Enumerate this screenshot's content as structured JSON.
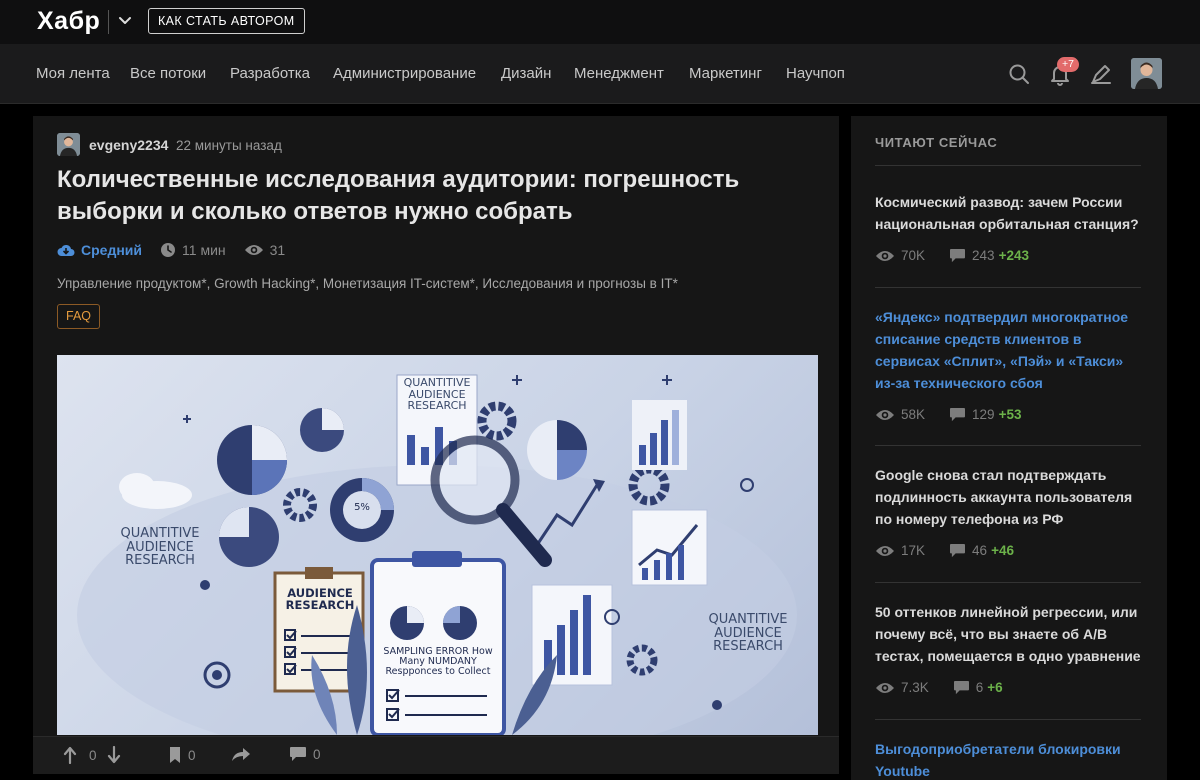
{
  "header": {
    "logo": "Хабр",
    "author_button": "КАК СТАТЬ АВТОРОМ",
    "notifications_badge": "+7"
  },
  "nav": {
    "items": [
      "Моя лента",
      "Все потоки",
      "Разработка",
      "Администрирование",
      "Дизайн",
      "Менеджмент",
      "Маркетинг",
      "Научпоп"
    ]
  },
  "article": {
    "author": "evgeny2234",
    "time": "22 минуты назад",
    "title": "Количественные исследования аудитории: погрешность выборки и сколько ответов нужно собрать",
    "level": "Средний",
    "read_time": "11 мин",
    "views": "31",
    "hubs": "Управление продуктом*, Growth Hacking*, Монетизация IT-систем*, Исследования и прогнозы в IT*",
    "badge": "FAQ",
    "cover_texts": {
      "top": "QUANTITIVE AUDIENCE RESEARCH",
      "left": "QUANTITIVE AUDIENCE RESEARCH",
      "right": "QUANTITIVE AUDIENCE RESEARCH",
      "clipboard": "AUDIENCE RESEARCH",
      "center": "SAMPLING ERROR How Many NUMDANY Respponces to Collect",
      "pie_label": "5%"
    },
    "footer": {
      "rating": "0",
      "bookmarks": "0",
      "comments": "0"
    }
  },
  "sidebar": {
    "title": "ЧИТАЮТ СЕЙЧАС",
    "posts": [
      {
        "title": "Космический развод: зачем России национальная орбитальная станция?",
        "views": "70K",
        "comments": "243",
        "delta": "+243",
        "highlight": false
      },
      {
        "title": "«Яндекс» подтвердил многократное списание средств клиентов в сервисах «Сплит», «Пэй» и «Такси» из-за технического сбоя",
        "views": "58K",
        "comments": "129",
        "delta": "+53",
        "highlight": true
      },
      {
        "title": "Google снова стал подтверждать подлинность аккаунта пользователя по номеру телефона из РФ",
        "views": "17K",
        "comments": "46",
        "delta": "+46",
        "highlight": false
      },
      {
        "title": "50 оттенков линейной регрессии, или почему всё, что вы знаете об A/B тестах, помещается в одно уравнение",
        "views": "7.3K",
        "comments": "6",
        "delta": "+6",
        "highlight": false
      },
      {
        "title": "Выгодоприобретатели блокировки Youtube",
        "highlight": true
      }
    ]
  },
  "colors": {
    "accent_blue": "#4d8ed8",
    "positive_green": "#6cb24a",
    "faq_orange": "#e59b3e",
    "badge_red": "#e26b6b"
  }
}
